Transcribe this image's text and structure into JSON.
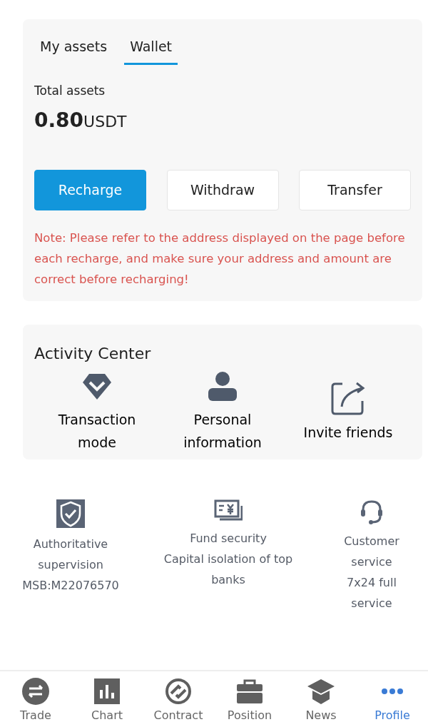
{
  "tabs": [
    {
      "label": "My assets",
      "selected": false
    },
    {
      "label": "Wallet",
      "selected": true
    }
  ],
  "total_assets": {
    "label": "Total assets",
    "amount": "0.80",
    "unit": "USDT"
  },
  "actions": [
    {
      "label": "Recharge",
      "primary": true
    },
    {
      "label": "Withdraw",
      "primary": false
    },
    {
      "label": "Transfer",
      "primary": false
    }
  ],
  "note": "Note: Please refer to the address displayed on the page before each recharge, and make sure your address and amount are correct before recharging!",
  "activity_center": {
    "title": "Activity Center",
    "items": [
      {
        "label": "Transaction mode"
      },
      {
        "label": "Personal information"
      },
      {
        "label": "Invite friends"
      }
    ]
  },
  "features": [
    {
      "lines": [
        "Authoritative supervision",
        "MSB:M22076570"
      ]
    },
    {
      "lines": [
        "Fund security",
        "Capital isolation of top banks"
      ]
    },
    {
      "lines": [
        "Customer service",
        "7x24 full service"
      ]
    }
  ],
  "bottom_nav": [
    {
      "label": "Trade",
      "selected": false
    },
    {
      "label": "Chart",
      "selected": false
    },
    {
      "label": "Contract",
      "selected": false
    },
    {
      "label": "Position",
      "selected": false
    },
    {
      "label": "News",
      "selected": false
    },
    {
      "label": "Profile",
      "selected": true
    }
  ]
}
